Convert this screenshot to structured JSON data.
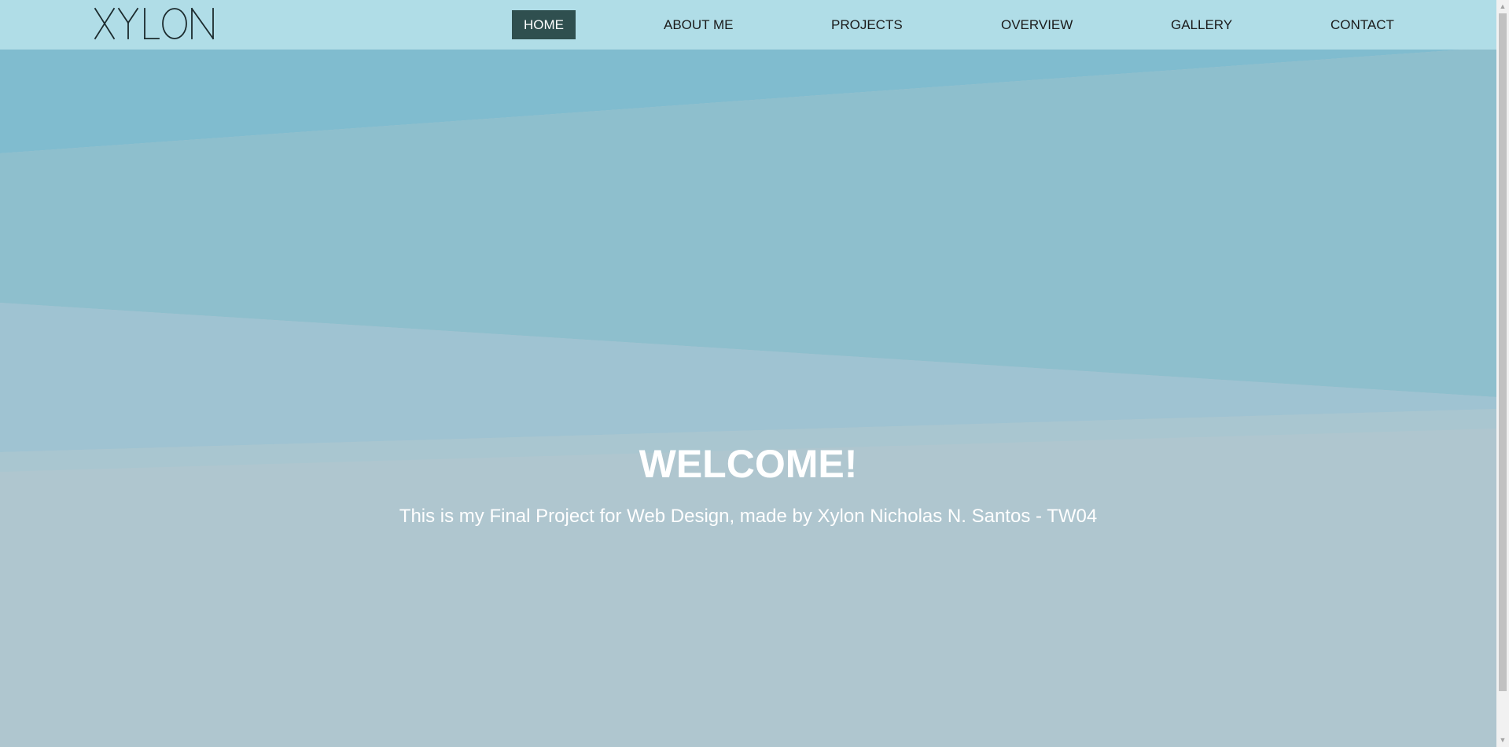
{
  "header": {
    "logo_text": "XYLON",
    "nav": [
      {
        "label": "HOME",
        "active": true
      },
      {
        "label": "ABOUT ME",
        "active": false
      },
      {
        "label": "PROJECTS",
        "active": false
      },
      {
        "label": "OVERVIEW",
        "active": false
      },
      {
        "label": "GALLERY",
        "active": false
      },
      {
        "label": "CONTACT",
        "active": false
      }
    ]
  },
  "hero": {
    "title": "WELCOME!",
    "subtitle": "This is my Final Project for Web Design, made by Xylon Nicholas N. Santos - TW04"
  },
  "colors": {
    "navbar_bg": "#b4dfe9",
    "active_nav_bg": "#2f4f4f",
    "hero_top": "#84bfcf",
    "hero_bottom": "#afc6cf",
    "text_white": "#ffffff"
  },
  "icons": {
    "scroll_up": "scroll-up-arrow-icon",
    "scroll_down": "scroll-down-arrow-icon"
  }
}
